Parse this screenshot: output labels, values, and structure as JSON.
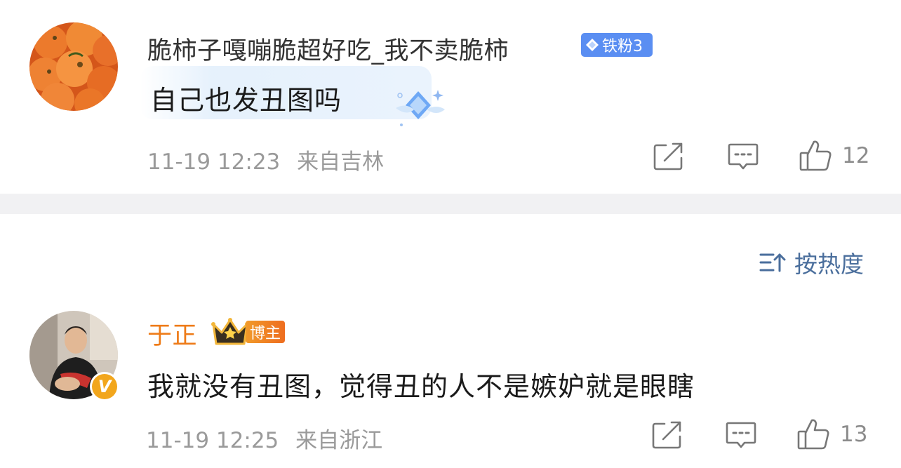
{
  "comments": [
    {
      "username": "脆柿子嘎嘣脆超好吃_我不卖脆柿",
      "badge": "铁粉3",
      "content": "自己也发丑图吗",
      "time": "11-19 12:23",
      "location": "来自吉林",
      "likes": "12",
      "avatar_icon": "persimmon-avatar-icon"
    },
    {
      "username": "于正",
      "badge": "博主",
      "content": "我就没有丑图，觉得丑的人不是嫉妒就是眼瞎",
      "time": "11-19 12:25",
      "location": "来自浙江",
      "likes": "13",
      "avatar_icon": "person-avatar-icon",
      "verified_mark": "V"
    }
  ],
  "sort": {
    "label": "按热度",
    "icon": "sort-icon"
  },
  "colors": {
    "vip_name": "#ee7b18",
    "fan_badge": "#5a8ef2",
    "sort_text": "#4a6e9c",
    "meta_text": "#9a9a9a",
    "divider": "#f1f1f3"
  }
}
